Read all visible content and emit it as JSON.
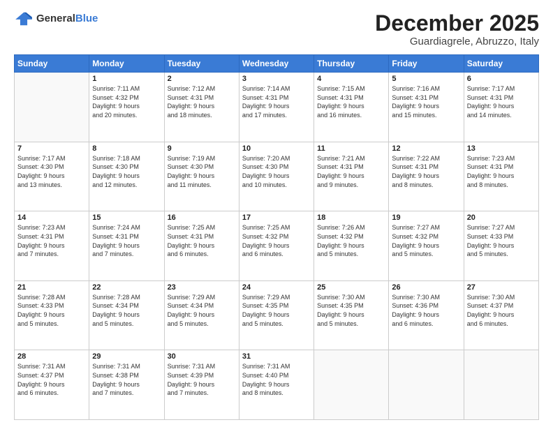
{
  "header": {
    "logo": {
      "general": "General",
      "blue": "Blue"
    },
    "title": "December 2025",
    "location": "Guardiagrele, Abruzzo, Italy"
  },
  "days_of_week": [
    "Sunday",
    "Monday",
    "Tuesday",
    "Wednesday",
    "Thursday",
    "Friday",
    "Saturday"
  ],
  "weeks": [
    [
      {
        "day": "",
        "info": ""
      },
      {
        "day": "1",
        "info": "Sunrise: 7:11 AM\nSunset: 4:32 PM\nDaylight: 9 hours\nand 20 minutes."
      },
      {
        "day": "2",
        "info": "Sunrise: 7:12 AM\nSunset: 4:31 PM\nDaylight: 9 hours\nand 18 minutes."
      },
      {
        "day": "3",
        "info": "Sunrise: 7:14 AM\nSunset: 4:31 PM\nDaylight: 9 hours\nand 17 minutes."
      },
      {
        "day": "4",
        "info": "Sunrise: 7:15 AM\nSunset: 4:31 PM\nDaylight: 9 hours\nand 16 minutes."
      },
      {
        "day": "5",
        "info": "Sunrise: 7:16 AM\nSunset: 4:31 PM\nDaylight: 9 hours\nand 15 minutes."
      },
      {
        "day": "6",
        "info": "Sunrise: 7:17 AM\nSunset: 4:31 PM\nDaylight: 9 hours\nand 14 minutes."
      }
    ],
    [
      {
        "day": "7",
        "info": "Sunrise: 7:17 AM\nSunset: 4:30 PM\nDaylight: 9 hours\nand 13 minutes."
      },
      {
        "day": "8",
        "info": "Sunrise: 7:18 AM\nSunset: 4:30 PM\nDaylight: 9 hours\nand 12 minutes."
      },
      {
        "day": "9",
        "info": "Sunrise: 7:19 AM\nSunset: 4:30 PM\nDaylight: 9 hours\nand 11 minutes."
      },
      {
        "day": "10",
        "info": "Sunrise: 7:20 AM\nSunset: 4:30 PM\nDaylight: 9 hours\nand 10 minutes."
      },
      {
        "day": "11",
        "info": "Sunrise: 7:21 AM\nSunset: 4:31 PM\nDaylight: 9 hours\nand 9 minutes."
      },
      {
        "day": "12",
        "info": "Sunrise: 7:22 AM\nSunset: 4:31 PM\nDaylight: 9 hours\nand 8 minutes."
      },
      {
        "day": "13",
        "info": "Sunrise: 7:23 AM\nSunset: 4:31 PM\nDaylight: 9 hours\nand 8 minutes."
      }
    ],
    [
      {
        "day": "14",
        "info": "Sunrise: 7:23 AM\nSunset: 4:31 PM\nDaylight: 9 hours\nand 7 minutes."
      },
      {
        "day": "15",
        "info": "Sunrise: 7:24 AM\nSunset: 4:31 PM\nDaylight: 9 hours\nand 7 minutes."
      },
      {
        "day": "16",
        "info": "Sunrise: 7:25 AM\nSunset: 4:31 PM\nDaylight: 9 hours\nand 6 minutes."
      },
      {
        "day": "17",
        "info": "Sunrise: 7:25 AM\nSunset: 4:32 PM\nDaylight: 9 hours\nand 6 minutes."
      },
      {
        "day": "18",
        "info": "Sunrise: 7:26 AM\nSunset: 4:32 PM\nDaylight: 9 hours\nand 5 minutes."
      },
      {
        "day": "19",
        "info": "Sunrise: 7:27 AM\nSunset: 4:32 PM\nDaylight: 9 hours\nand 5 minutes."
      },
      {
        "day": "20",
        "info": "Sunrise: 7:27 AM\nSunset: 4:33 PM\nDaylight: 9 hours\nand 5 minutes."
      }
    ],
    [
      {
        "day": "21",
        "info": "Sunrise: 7:28 AM\nSunset: 4:33 PM\nDaylight: 9 hours\nand 5 minutes."
      },
      {
        "day": "22",
        "info": "Sunrise: 7:28 AM\nSunset: 4:34 PM\nDaylight: 9 hours\nand 5 minutes."
      },
      {
        "day": "23",
        "info": "Sunrise: 7:29 AM\nSunset: 4:34 PM\nDaylight: 9 hours\nand 5 minutes."
      },
      {
        "day": "24",
        "info": "Sunrise: 7:29 AM\nSunset: 4:35 PM\nDaylight: 9 hours\nand 5 minutes."
      },
      {
        "day": "25",
        "info": "Sunrise: 7:30 AM\nSunset: 4:35 PM\nDaylight: 9 hours\nand 5 minutes."
      },
      {
        "day": "26",
        "info": "Sunrise: 7:30 AM\nSunset: 4:36 PM\nDaylight: 9 hours\nand 6 minutes."
      },
      {
        "day": "27",
        "info": "Sunrise: 7:30 AM\nSunset: 4:37 PM\nDaylight: 9 hours\nand 6 minutes."
      }
    ],
    [
      {
        "day": "28",
        "info": "Sunrise: 7:31 AM\nSunset: 4:37 PM\nDaylight: 9 hours\nand 6 minutes."
      },
      {
        "day": "29",
        "info": "Sunrise: 7:31 AM\nSunset: 4:38 PM\nDaylight: 9 hours\nand 7 minutes."
      },
      {
        "day": "30",
        "info": "Sunrise: 7:31 AM\nSunset: 4:39 PM\nDaylight: 9 hours\nand 7 minutes."
      },
      {
        "day": "31",
        "info": "Sunrise: 7:31 AM\nSunset: 4:40 PM\nDaylight: 9 hours\nand 8 minutes."
      },
      {
        "day": "",
        "info": ""
      },
      {
        "day": "",
        "info": ""
      },
      {
        "day": "",
        "info": ""
      }
    ]
  ]
}
